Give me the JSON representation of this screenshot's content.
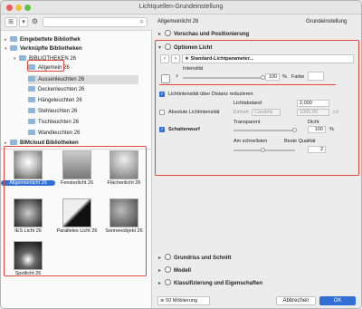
{
  "window": {
    "title": "Lichtquellen-Grundeinstellung"
  },
  "tree": {
    "embedded": "Eingebettete Bibliothek",
    "linked": "Verknüpfte Bibliotheken",
    "folder": "BIBLIOTHEKEN 26",
    "items": [
      "Allgemein 26",
      "Aussenleuchten 26",
      "Deckenleuchten 26",
      "Hängeleuchten 26",
      "Stehleuchten 26",
      "Tischleuchten 26",
      "Wandleuchten 26"
    ],
    "bimcloud": "BIMcloud Bibliotheken"
  },
  "thumbnails": [
    "Allgemeinlicht 26",
    "Fensterlicht 26",
    "Flächenlicht 26",
    "IES Licht 26",
    "Paralleles Licht 26",
    "Sonnenobjekt 26",
    "Spotlicht 26"
  ],
  "right": {
    "object_name": "Allgemeinlicht 26",
    "default_label": "Grundeinstellung",
    "sections": {
      "preview": "Vorschau und Positionierung",
      "light": "Optionen Licht",
      "floorplan": "Grundriss und Schnitt",
      "model": "Modell",
      "classification": "Klassifizierung und Eigenschaften"
    },
    "preset": "Standard-Lichtparameter...",
    "intensity_label": "Intensität",
    "intensity_value": "100",
    "percent": "%",
    "color_label": "Farbe",
    "reduce_label": "Lichtintensität über Distanz reduzieren",
    "distance_label": "Lichtabstand",
    "distance_value": "2,000",
    "unit_label": "Einheit",
    "unit_value": "Candela",
    "abs_label": "Absolute Lichtintensität",
    "abs_value": "1000,00",
    "cd": "cd",
    "shadow_label": "Schattenwurf",
    "transparent_label": "Transparent",
    "density_label": "Dicht",
    "density_value": "100",
    "fast_label": "Am schnellsten",
    "quality_label": "Beste Qualität",
    "quality_value": "2"
  },
  "footer": {
    "layer": "50 Möblierung",
    "cancel": "Abbrechen",
    "ok": "OK"
  }
}
